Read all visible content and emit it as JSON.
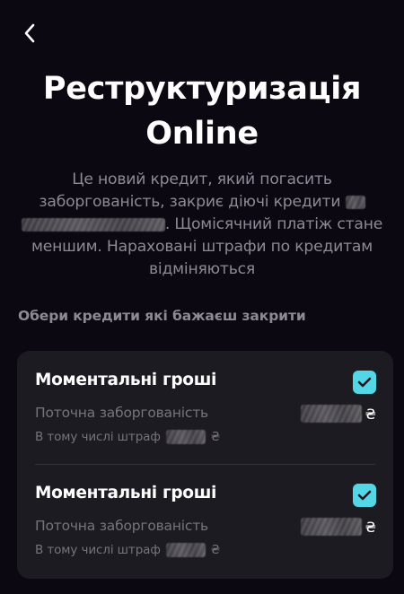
{
  "header": {
    "title_line1": "Реструктуризація",
    "title_line2": "Online"
  },
  "description": {
    "line1": "Це новий кредит, який погасить",
    "line2": "заборгованість, закриє діючі  кредити",
    "line3": ". Щомісячний платіж стане",
    "line4": "меншим. Нараховані штрафи по кредитам",
    "line5": "відміняються"
  },
  "section_label": "Обери кредити які бажаєш закрити",
  "loans": [
    {
      "name": "Моментальні гроші",
      "debt_label": "Поточна заборгованість",
      "currency": "₴",
      "fine_label": "В тому числі штраф",
      "fine_currency": "₴",
      "checked": true
    },
    {
      "name": "Моментальні гроші",
      "debt_label": "Поточна заборгованість",
      "currency": "₴",
      "fine_label": "В тому числі штраф",
      "fine_currency": "₴",
      "checked": true
    }
  ],
  "colors": {
    "background": "#0c0812",
    "card": "#1d1b22",
    "checkbox": "#53d6e6",
    "muted_text": "#8e8a94"
  },
  "icons": {
    "back": "chevron-left-icon",
    "check": "checkmark-icon"
  }
}
